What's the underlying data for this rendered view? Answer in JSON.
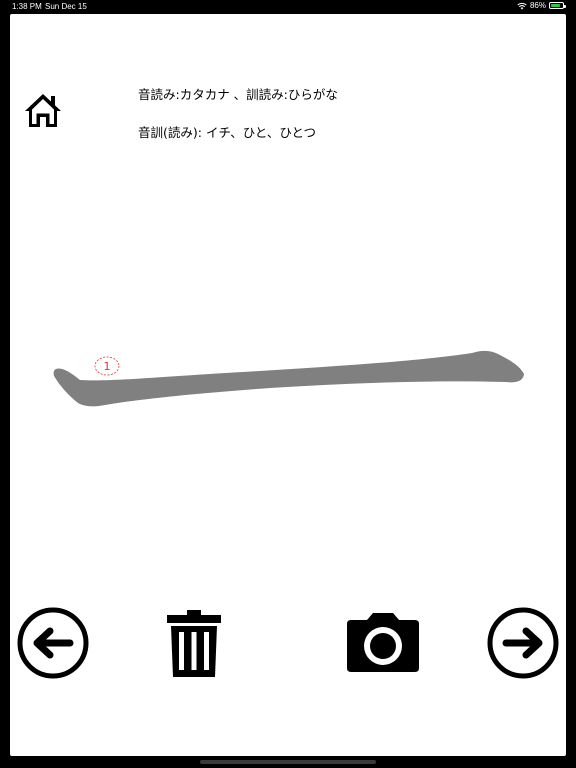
{
  "status_bar": {
    "time": "1:38 PM",
    "date": "Sun Dec 15",
    "battery_percent": "86%",
    "battery_level": 0.86,
    "icons": [
      "wifi-icon",
      "battery-icon"
    ]
  },
  "readings": {
    "legend": "音読み:カタカナ 、訓読み:ひらがな",
    "kanji_readings": "音訓(読み): イチ、ひと、ひとつ"
  },
  "stroke_guide": {
    "stroke_number": "1",
    "stroke_color": "#808080",
    "number_color": "#e03030"
  },
  "toolbar": {
    "icons": [
      "home-icon",
      "arrow-left-circle-icon",
      "trash-icon",
      "camera-icon",
      "arrow-right-circle-icon"
    ]
  }
}
